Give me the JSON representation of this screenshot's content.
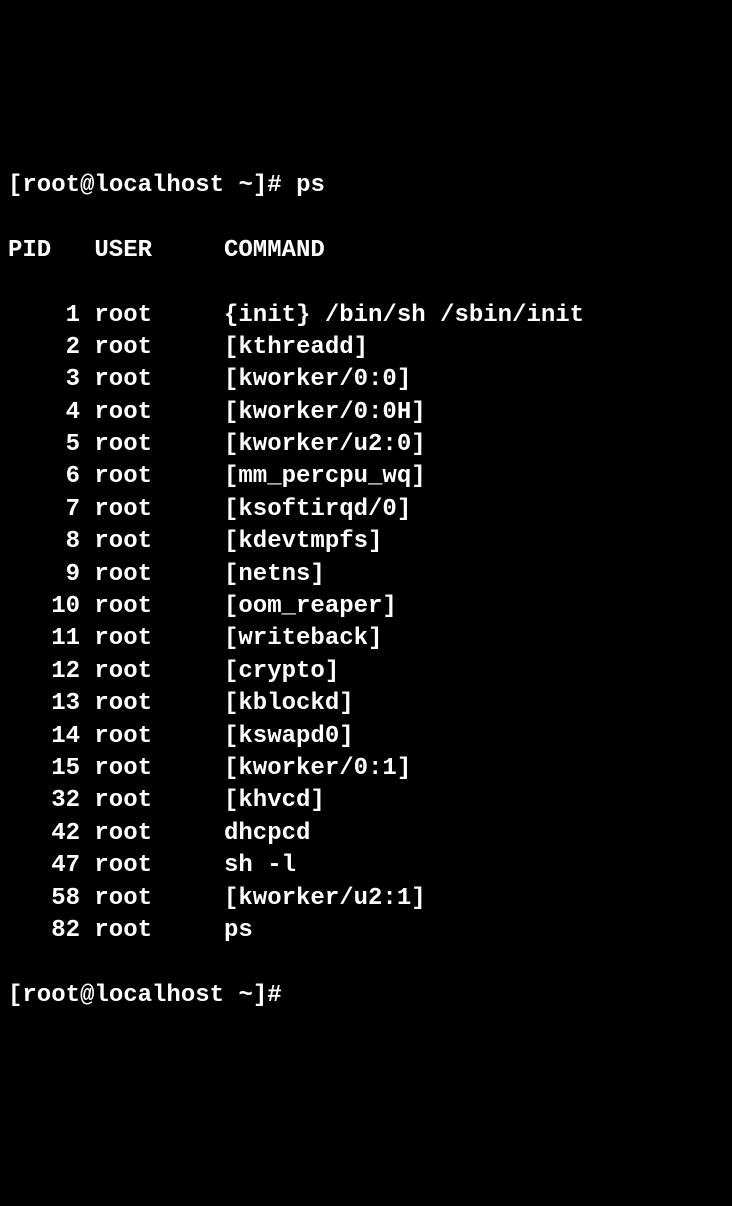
{
  "prompt1": {
    "prefix": "[root@localhost ~]#",
    "command": "ps"
  },
  "header": {
    "pid": "PID",
    "user": "USER",
    "command": "COMMAND"
  },
  "processes": [
    {
      "pid": "1",
      "user": "root",
      "command": "{init} /bin/sh /sbin/init"
    },
    {
      "pid": "2",
      "user": "root",
      "command": "[kthreadd]"
    },
    {
      "pid": "3",
      "user": "root",
      "command": "[kworker/0:0]"
    },
    {
      "pid": "4",
      "user": "root",
      "command": "[kworker/0:0H]"
    },
    {
      "pid": "5",
      "user": "root",
      "command": "[kworker/u2:0]"
    },
    {
      "pid": "6",
      "user": "root",
      "command": "[mm_percpu_wq]"
    },
    {
      "pid": "7",
      "user": "root",
      "command": "[ksoftirqd/0]"
    },
    {
      "pid": "8",
      "user": "root",
      "command": "[kdevtmpfs]"
    },
    {
      "pid": "9",
      "user": "root",
      "command": "[netns]"
    },
    {
      "pid": "10",
      "user": "root",
      "command": "[oom_reaper]"
    },
    {
      "pid": "11",
      "user": "root",
      "command": "[writeback]"
    },
    {
      "pid": "12",
      "user": "root",
      "command": "[crypto]"
    },
    {
      "pid": "13",
      "user": "root",
      "command": "[kblockd]"
    },
    {
      "pid": "14",
      "user": "root",
      "command": "[kswapd0]"
    },
    {
      "pid": "15",
      "user": "root",
      "command": "[kworker/0:1]"
    },
    {
      "pid": "32",
      "user": "root",
      "command": "[khvcd]"
    },
    {
      "pid": "42",
      "user": "root",
      "command": "dhcpcd"
    },
    {
      "pid": "47",
      "user": "root",
      "command": "sh -l"
    },
    {
      "pid": "58",
      "user": "root",
      "command": "[kworker/u2:1]"
    },
    {
      "pid": "82",
      "user": "root",
      "command": "ps"
    }
  ],
  "prompt2": {
    "prefix": "[root@localhost ~]#"
  }
}
